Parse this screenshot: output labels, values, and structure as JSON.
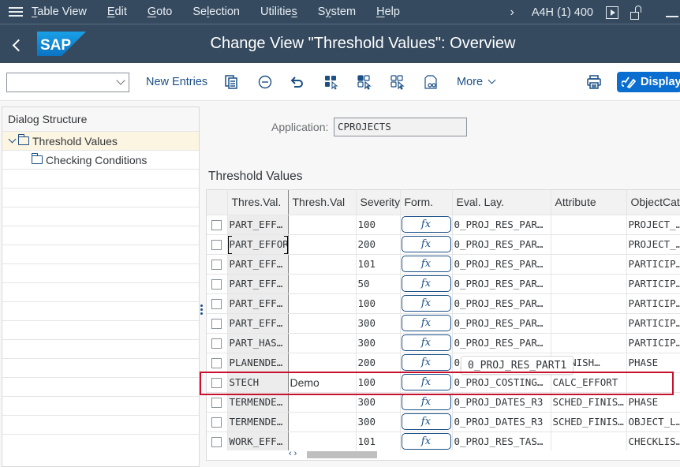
{
  "menubar": {
    "items": [
      {
        "label": "Table View",
        "u": "T",
        "rest": "able View",
        "pre": ""
      },
      {
        "label": "Edit",
        "pre": "",
        "u": "E",
        "rest": "dit"
      },
      {
        "label": "Goto",
        "pre": "",
        "u": "G",
        "rest": "oto"
      },
      {
        "label": "Selection",
        "pre": "Se",
        "u": "l",
        "rest": "ection"
      },
      {
        "label": "Utilities",
        "pre": "Utilitie",
        "u": "s",
        "rest": ""
      },
      {
        "label": "System",
        "pre": "S",
        "u": "y",
        "rest": "stem"
      },
      {
        "label": "Help",
        "pre": "",
        "u": "H",
        "rest": "elp"
      }
    ],
    "system_id": "A4H (1) 400"
  },
  "titlebar": {
    "logo_text": "SAP",
    "title": "Change View \"Threshold Values\": Overview"
  },
  "toolbar": {
    "command_field_value": "",
    "new_entries": "New Entries",
    "more": "More",
    "display": "Display",
    "colors": {
      "primary": "#0a6ed1",
      "shell": "#354a5f"
    }
  },
  "dialog_structure": {
    "header": "Dialog Structure",
    "items": [
      {
        "label": "Threshold Values",
        "level": 0,
        "expanded": true,
        "selected": true
      },
      {
        "label": "Checking Conditions",
        "level": 1,
        "expanded": false,
        "selected": false
      }
    ]
  },
  "application": {
    "label": "Application:",
    "value": "CPROJECTS"
  },
  "table": {
    "title": "Threshold Values",
    "columns": [
      "Thres.Val.",
      "Thresh.Val",
      "Severity",
      "Form.",
      "Eval. Lay.",
      "Attribute",
      "ObjectCat."
    ],
    "formula_label": "fx",
    "rows": [
      {
        "thres_val": "PART_EFF…",
        "thresh_val": "",
        "severity": "100",
        "eval_lay": "0_PROJ_RES_PAR…",
        "attribute": "",
        "object_cat": "PROJECT_…"
      },
      {
        "thres_val": "PART_EFFOR",
        "thresh_val": "",
        "severity": "200",
        "eval_lay": "0_PROJ_RES_PAR…",
        "attribute": "",
        "object_cat": "PROJECT_…"
      },
      {
        "thres_val": "PART_EFF…",
        "thresh_val": "",
        "severity": "101",
        "eval_lay": "0_PROJ_RES_PAR…",
        "attribute": "",
        "object_cat": "PARTICIP…"
      },
      {
        "thres_val": "PART_EFF…",
        "thresh_val": "",
        "severity": "50",
        "eval_lay": "0_PROJ_RES_PAR…",
        "attribute": "",
        "object_cat": "PARTICIP…"
      },
      {
        "thres_val": "PART_EFF…",
        "thresh_val": "",
        "severity": "100",
        "eval_lay": "0_PROJ_RES_PAR…",
        "attribute": "",
        "object_cat": "PARTICIP…"
      },
      {
        "thres_val": "PART_EFF…",
        "thresh_val": "",
        "severity": "300",
        "eval_lay": "0_PROJ_RES_PAR…",
        "attribute": "",
        "object_cat": "PARTICIP…"
      },
      {
        "thres_val": "PART_HAS…",
        "thresh_val": "",
        "severity": "300",
        "eval_lay": "0_PROJ_RES_PAR…",
        "attribute": "",
        "object_cat": "PARTICIP…"
      },
      {
        "thres_val": "PLANENDE…",
        "thresh_val": "",
        "severity": "200",
        "eval_lay": "0_PROJ_RES_PAR…",
        "attribute": "…FINISH…",
        "object_cat": "PHASE"
      },
      {
        "thres_val": "STECH",
        "thresh_val": "Demo",
        "severity": "100",
        "eval_lay": "0_PROJ_COSTING…",
        "attribute": "CALC_EFFORT",
        "object_cat": "",
        "highlighted": true
      },
      {
        "thres_val": "TERMENDE…",
        "thresh_val": "",
        "severity": "300",
        "eval_lay": "0_PROJ_DATES_R3",
        "attribute": "SCHED_FINIS…",
        "object_cat": "PHASE"
      },
      {
        "thres_val": "TERMENDE…",
        "thresh_val": "",
        "severity": "300",
        "eval_lay": "0_PROJ_DATES_R3",
        "attribute": "SCHED_FINIS…",
        "object_cat": "OBJECT_L…"
      },
      {
        "thres_val": "WORK_EFF…",
        "thresh_val": "",
        "severity": "101",
        "eval_lay": "0_PROJ_RES_TAS…",
        "attribute": "",
        "object_cat": "CHECKLIS…"
      }
    ],
    "tooltip": "0_PROJ_RES_PART1",
    "highlight_color": "#c8102e"
  }
}
